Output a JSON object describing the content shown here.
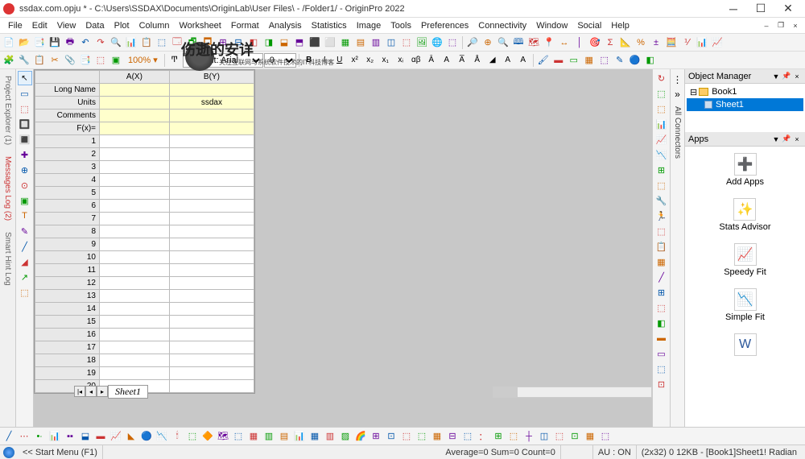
{
  "title": "ssdax.com.opju * - C:\\Users\\SSDAX\\Documents\\OriginLab\\User Files\\ - /Folder1/ - OriginPro 2022",
  "menu": [
    "File",
    "Edit",
    "View",
    "Data",
    "Plot",
    "Column",
    "Worksheet",
    "Format",
    "Analysis",
    "Statistics",
    "Image",
    "Tools",
    "Preferences",
    "Connectivity",
    "Window",
    "Social",
    "Help"
  ],
  "font": {
    "label": "Default: Arial",
    "size": "0"
  },
  "watermark": {
    "main": "伤逝的安详",
    "sub": "关注互联网与系统软件技术的IT科技博客"
  },
  "left_tabs": [
    "Project Explorer (1)",
    "Messages Log (2)",
    "Smart Hint Log"
  ],
  "worksheet": {
    "columns": [
      "A(X)",
      "B(Y)"
    ],
    "meta_rows": [
      "Long Name",
      "Units",
      "Comments",
      "F(x)="
    ],
    "cell_b_units": "ssdax",
    "data_rows": 20,
    "tab": "Sheet1"
  },
  "right_vtext": {
    "label": "All Connectors",
    "menu": "⋮",
    "chev": "»"
  },
  "object_manager": {
    "title": "Object Manager",
    "book": "Book1",
    "sheet": "Sheet1"
  },
  "apps_panel": {
    "title": "Apps",
    "items": [
      {
        "name": "Add Apps",
        "icon": "➕",
        "color": "#3a3"
      },
      {
        "name": "Stats Advisor",
        "icon": "✨",
        "color": "#c90"
      },
      {
        "name": "Speedy Fit",
        "icon": "📈",
        "color": "#05a"
      },
      {
        "name": "Simple Fit",
        "icon": "📉",
        "color": "#36c"
      }
    ]
  },
  "statusbar": {
    "start": "<< Start Menu (F1)",
    "stats": "Average=0 Sum=0 Count=0",
    "au": "AU : ON",
    "mem": "(2x32) 0 12KB - [Book1]Sheet1! Radian"
  },
  "main_tb1": [
    "📄",
    "📂",
    "📑",
    "💾",
    "🖶",
    "↶",
    "↷",
    "🔍",
    "📊",
    "📋",
    "⬚",
    "🗔",
    "🗗",
    "🗖",
    "⊞",
    "⊟",
    "◧",
    "◨",
    "⬓",
    "⬒",
    "⬛",
    "⬜",
    "▦",
    "▤",
    "▥",
    "◫",
    "⬚",
    "🖼",
    "🌐",
    "⬚"
  ],
  "main_tb1b": [
    "🔎",
    "⊕",
    "🔍",
    "🕮",
    "🗺",
    "📍",
    "↔",
    "│",
    "🎯",
    "Σ",
    "📐",
    "%",
    "±",
    "🧮",
    "⅟",
    "📊",
    "📈"
  ],
  "main_tb2": [
    "🧩",
    "🔧",
    "📋",
    "✂",
    "📎",
    "📑",
    "⬚",
    "▣",
    "100% ▾"
  ],
  "style_tb": [
    "B",
    "I",
    "U",
    "x²",
    "x₂",
    "x₁",
    "xᵢ",
    "αβ",
    "Ā",
    "A",
    "A̅",
    "Å",
    "◢",
    "A",
    "A"
  ],
  "color_tb": [
    "🖌",
    "▬",
    "▭",
    "▦",
    "⬚",
    "✎",
    "🔵",
    "◧"
  ],
  "left_palette": [
    "▭",
    "⬚",
    "🔲",
    "🔳",
    "✚",
    "⊕",
    "⊙",
    "▣",
    "T",
    "✎",
    "╱",
    "◢",
    "↗",
    "⬚"
  ],
  "right_palette": [
    "↻",
    "⬚",
    "⬚",
    "📊",
    "📈",
    "📉",
    "⊞",
    "⬚",
    "🔧",
    "🏃",
    "⬚",
    "📋",
    "▦",
    "╱",
    "⊞",
    "⬚",
    "◧",
    "▬",
    "▭",
    "⬚",
    "⊡"
  ],
  "plot_tb": [
    "╱",
    "⋯",
    "•∙",
    "📊",
    "▪▪",
    "⬓",
    "▬",
    "📈",
    "◣",
    "🔵",
    "📉",
    "🕯",
    "⬚",
    "🔶",
    "🗺",
    "⬚",
    "▦",
    "▥",
    "▤",
    "📊",
    "▦",
    "▥",
    "▨",
    "🌈",
    "⊞",
    "⊡",
    "⬚",
    "⬚",
    "▦",
    "⊟",
    "⬚",
    "：",
    "⊞",
    "⬚",
    "┼",
    "◫",
    "⬚",
    "⊡",
    "▦",
    "⬚"
  ]
}
